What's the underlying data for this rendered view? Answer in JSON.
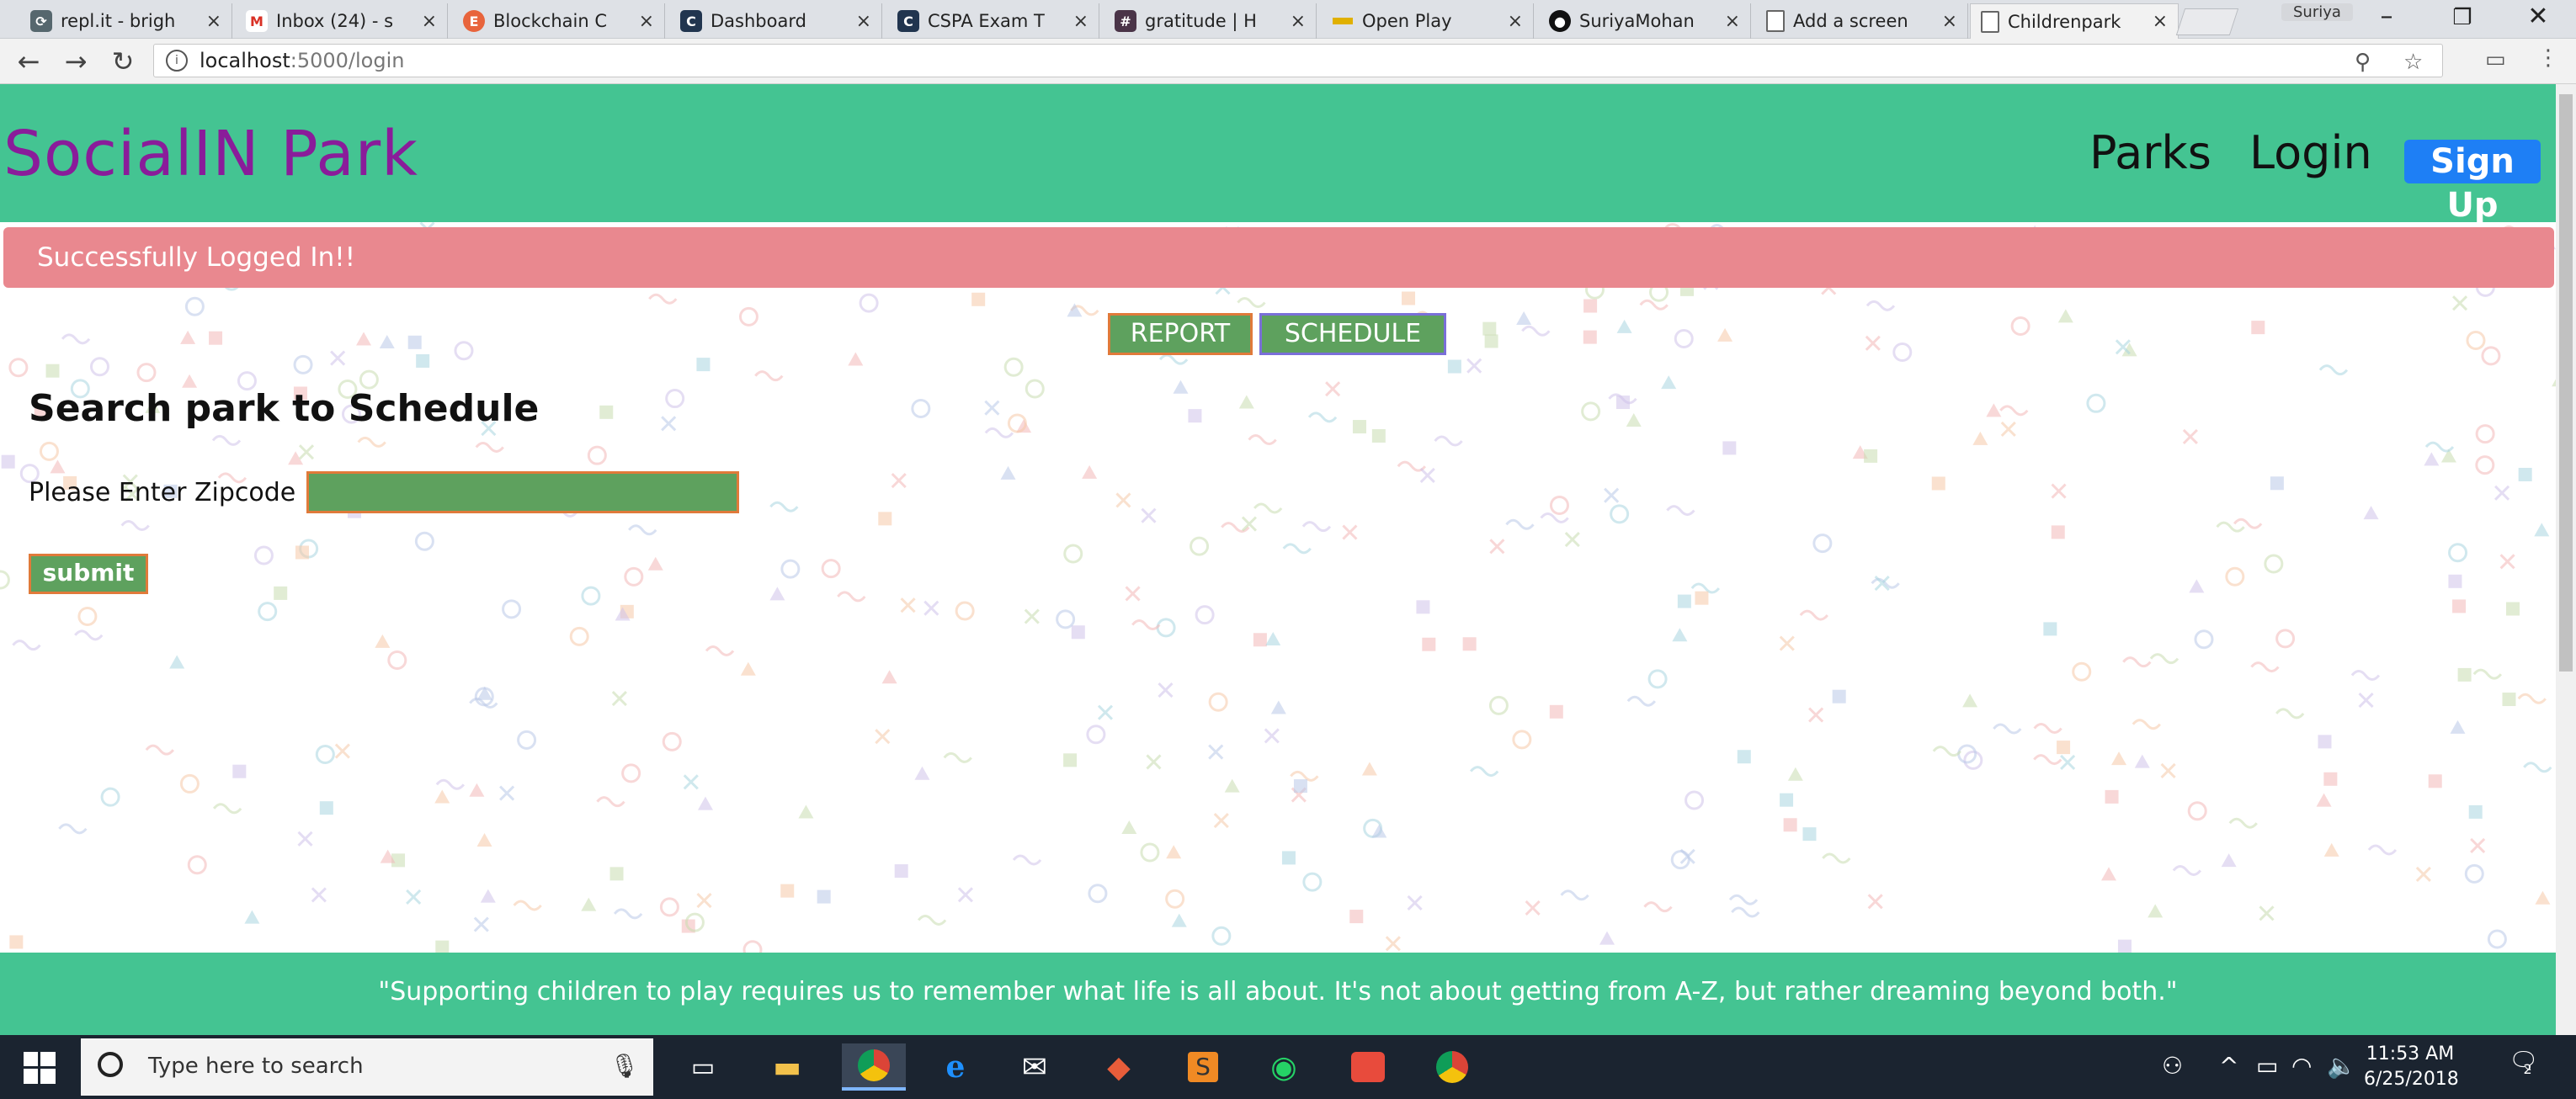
{
  "browser": {
    "tabs": [
      {
        "title": "repl.it - brigh",
        "icon": "replit-icon",
        "color": "#56676e"
      },
      {
        "title": "Inbox (24) - s",
        "icon": "gmail-icon",
        "color": "#d93025"
      },
      {
        "title": "Blockchain C",
        "icon": "blockchain-icon",
        "color": "#e8643c"
      },
      {
        "title": "Dashboard",
        "icon": "c-logo-icon",
        "color": "#21354f"
      },
      {
        "title": "CSPA Exam T",
        "icon": "c-logo-icon",
        "color": "#21354f"
      },
      {
        "title": "gratitude | H",
        "icon": "hashtag-icon",
        "color": "#4a3448"
      },
      {
        "title": "Open Play",
        "icon": "bar-icon",
        "color": "#e0b000"
      },
      {
        "title": "SuriyaMohan",
        "icon": "github-icon",
        "color": "#111111"
      },
      {
        "title": "Add a screen",
        "icon": "page-icon",
        "color": "#666666"
      },
      {
        "title": "Childrenpark",
        "icon": "page-icon",
        "color": "#666666"
      }
    ],
    "profile_name": "Suriya",
    "address": {
      "host": "localhost",
      "path": ":5000/login"
    }
  },
  "site": {
    "brand": "SocialIN Park",
    "nav": {
      "parks": "Parks",
      "login": "Login",
      "signup": "Sign Up"
    },
    "flash_message": "Successfully Logged In!!",
    "buttons": {
      "report": "REPORT",
      "schedule": "SCHEDULE"
    },
    "heading": "Search park to Schedule",
    "zip_label": "Please Enter Zipcode",
    "zip_value": "",
    "submit_label": "submit",
    "footer_quote": "\"Supporting children to play requires us to remember what life is all about. It's not about getting from A-Z, but rather dreaming beyond both.\"",
    "colors": {
      "header": "#44c492",
      "brand": "#8a1c9a",
      "flash": "#e9888f",
      "button": "#5ea15e",
      "signup": "#1e7ff5"
    }
  },
  "taskbar": {
    "search_placeholder": "Type here to search",
    "time": "11:53 AM",
    "date": "6/25/2018",
    "notifications": "2"
  }
}
